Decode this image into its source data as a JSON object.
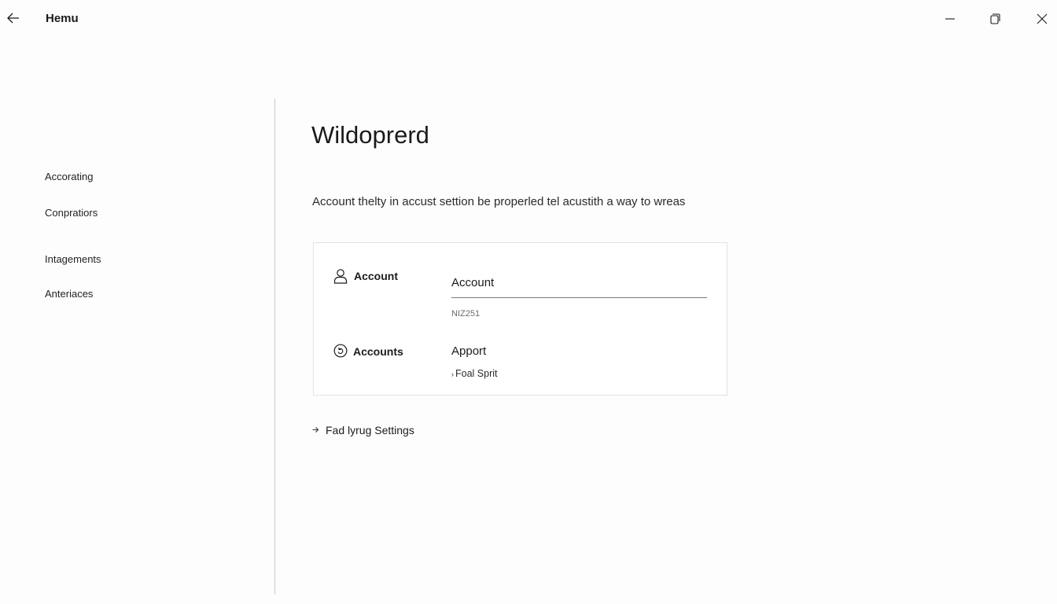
{
  "window": {
    "title": "Hemu",
    "back_icon": "arrow-left-icon",
    "minimize_icon": "minimize-icon",
    "maximize_icon": "maximize-icon",
    "close_icon": "close-icon"
  },
  "sidebar": {
    "items": [
      {
        "label": "Accorating"
      },
      {
        "label": "Conpratiors"
      },
      {
        "label": "Intagements"
      },
      {
        "label": "Anteriaces"
      }
    ]
  },
  "main": {
    "title": "Wildoprerd",
    "description": "Account thelty in accust settion be properled tel acustith a way to wreas",
    "card": {
      "account_row": {
        "icon": "person-icon",
        "label": "Account",
        "input_value": "Account",
        "hint": "NIZ251"
      },
      "accounts_row": {
        "icon": "circle-account-icon",
        "label": "Accounts",
        "value": "Apport",
        "sublink": "Foal Sprit",
        "sublink_icon": "chevron-right-icon"
      }
    },
    "settings_link": {
      "label": "Fad lyrug Settings",
      "icon": "arrow-right-icon"
    }
  }
}
